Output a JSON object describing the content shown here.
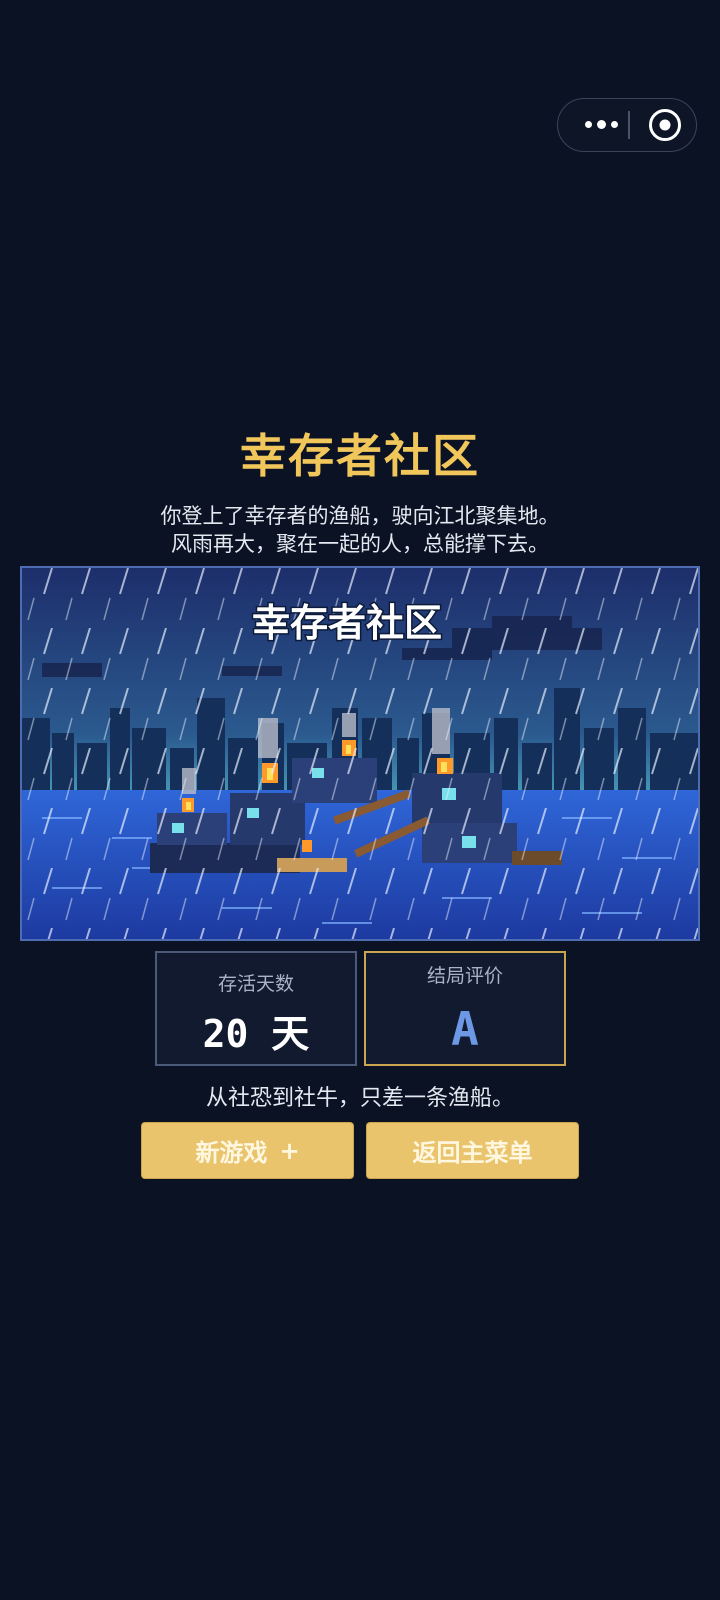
{
  "capsule": {
    "more_icon": "more-dots-icon",
    "close_icon": "target-close-icon"
  },
  "title": "幸存者社区",
  "description": [
    "你登上了幸存者的渔船，驶向江北聚集地。",
    "风雨再大，聚在一起的人，总能撑下去。"
  ],
  "scene": {
    "title": "幸存者社区"
  },
  "stats": {
    "days_label": "存活天数",
    "days_value": "20 天",
    "rating_label": "结局评价",
    "rating_value": "A"
  },
  "tagline": "从社恐到社牛，只差一条渔船。",
  "buttons": {
    "new_game": "新游戏",
    "new_game_icon": "+",
    "main_menu": "返回主菜单"
  },
  "colors": {
    "background": "#0b1224",
    "accent": "#f1c75b",
    "button": "#e9c46c",
    "rating": "#6d98e6"
  }
}
